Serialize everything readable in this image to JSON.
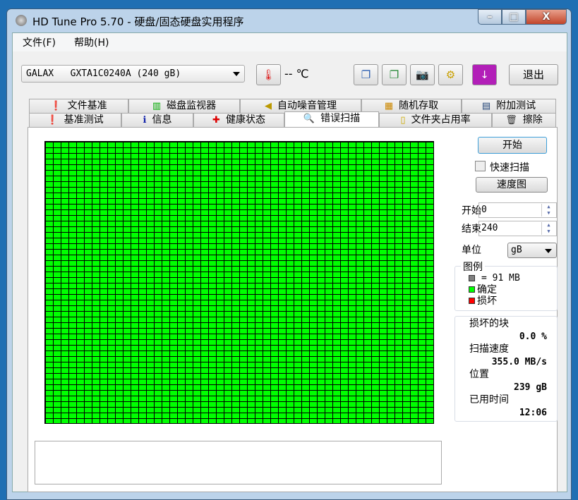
{
  "window": {
    "title": "HD Tune Pro 5.70 - 硬盘/固态硬盘实用程序",
    "minimize": "–",
    "maximize": "□",
    "close": "X"
  },
  "menu": [
    {
      "label": "文件(F)"
    },
    {
      "label": "帮助(H)"
    }
  ],
  "toolbar": {
    "drive": "GALAX   GXTA1C0240A (240 gB)",
    "temperature": "-- ℃",
    "exit": "退出",
    "icons": [
      "copy-info-icon",
      "copy-screenshot-icon",
      "camera-icon",
      "options-icon",
      "save-download-icon"
    ]
  },
  "tabs": {
    "row1": [
      {
        "label": "文件基准",
        "icon": "file-benchmark-icon"
      },
      {
        "label": "磁盘监视器",
        "icon": "disk-monitor-icon"
      },
      {
        "label": "自动噪音管理",
        "icon": "speaker-icon"
      },
      {
        "label": "随机存取",
        "icon": "random-access-icon"
      },
      {
        "label": "附加测试",
        "icon": "extra-tests-icon"
      }
    ],
    "row2": [
      {
        "label": "基准测试",
        "icon": "benchmark-icon"
      },
      {
        "label": "信息",
        "icon": "info-icon"
      },
      {
        "label": "健康状态",
        "icon": "health-icon"
      },
      {
        "label": "错误扫描",
        "icon": "magnifier-icon",
        "active": true
      },
      {
        "label": "文件夹占用率",
        "icon": "folder-icon"
      },
      {
        "label": "擦除",
        "icon": "trash-icon"
      }
    ]
  },
  "scan": {
    "start_button": "开始",
    "quick_scan": "快速扫描",
    "quick_scan_checked": false,
    "speed_map": "速度图",
    "start_label": "开始",
    "start_value": "0",
    "end_label": "结束",
    "end_value": "240",
    "unit_label": "单位",
    "unit_value": "gB",
    "legend": {
      "title": "图例",
      "block_size": "= 91 MB",
      "ok": "确定",
      "damaged": "损坏",
      "colors": {
        "block": "#808080",
        "ok": "#00ff00",
        "damaged": "#ff0000"
      }
    },
    "stats": {
      "damaged_blocks_label": "损坏的块",
      "damaged_blocks": "0.0 %",
      "speed_label": "扫描速度",
      "speed": "355.0 MB/s",
      "position_label": "位置",
      "position": "239 gB",
      "elapsed_label": "已用时间",
      "elapsed": "12:06"
    },
    "block_map": {
      "status": "all blocks ok",
      "ok_fraction": 1.0,
      "damaged_fraction": 0.0
    }
  }
}
